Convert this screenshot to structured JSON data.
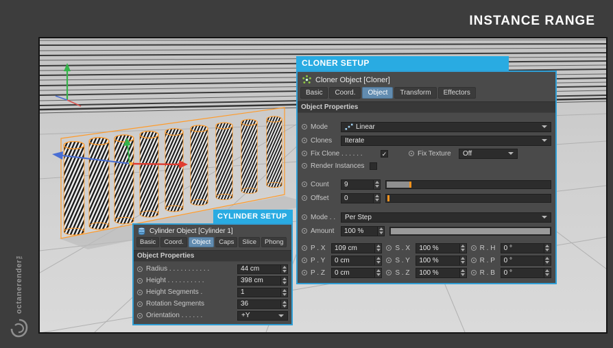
{
  "frame": {
    "title": "INSTANCE RANGE",
    "brand": "octanerender™"
  },
  "colors": {
    "accent_cyan": "#29abe2",
    "selection_orange": "#ff9b2a",
    "tab_selected": "#628cb0"
  },
  "cloner": {
    "header": "CLONER SETUP",
    "object_title": "Cloner Object [Cloner]",
    "tabs": [
      "Basic",
      "Coord.",
      "Object",
      "Transform",
      "Effectors"
    ],
    "selected_tab": "Object",
    "section": "Object Properties",
    "mode": {
      "label": "Mode",
      "value": "Linear"
    },
    "clones": {
      "label": "Clones",
      "value": "Iterate"
    },
    "fix_clone": {
      "label": "Fix Clone . . . . . .",
      "checked": true
    },
    "fix_texture": {
      "label": "Fix Texture",
      "value": "Off"
    },
    "render_instances": {
      "label": "Render Instances",
      "checked": false
    },
    "count": {
      "label": "Count",
      "value": "9"
    },
    "offset": {
      "label": "Offset",
      "value": "0"
    },
    "step_mode": {
      "label": "Mode . .",
      "value": "Per Step"
    },
    "amount": {
      "label": "Amount",
      "value": "100 %"
    },
    "transform": [
      {
        "p_label": "P . X",
        "p_value": "109 cm",
        "s_label": "S . X",
        "s_value": "100 %",
        "r_label": "R . H",
        "r_value": "0 °"
      },
      {
        "p_label": "P . Y",
        "p_value": "0 cm",
        "s_label": "S . Y",
        "s_value": "100 %",
        "r_label": "R . P",
        "r_value": "0 °"
      },
      {
        "p_label": "P . Z",
        "p_value": "0 cm",
        "s_label": "S . Z",
        "s_value": "100 %",
        "r_label": "R . B",
        "r_value": "0 °"
      }
    ]
  },
  "cylinder": {
    "header": "CYLINDER SETUP",
    "object_title": "Cylinder Object [Cylinder 1]",
    "tabs": [
      "Basic",
      "Coord.",
      "Object",
      "Caps",
      "Slice",
      "Phong"
    ],
    "selected_tab": "Object",
    "section": "Object Properties",
    "radius": {
      "label": "Radius . . . . . . . . . . .",
      "value": "44 cm"
    },
    "height": {
      "label": "Height . . . . . . . . . .",
      "value": "398 cm"
    },
    "height_segments": {
      "label": "Height Segments .",
      "value": "1"
    },
    "rotation_segments": {
      "label": "Rotation Segments",
      "value": "36"
    },
    "orientation": {
      "label": "Orientation . . . . . .",
      "value": "+Y"
    }
  }
}
